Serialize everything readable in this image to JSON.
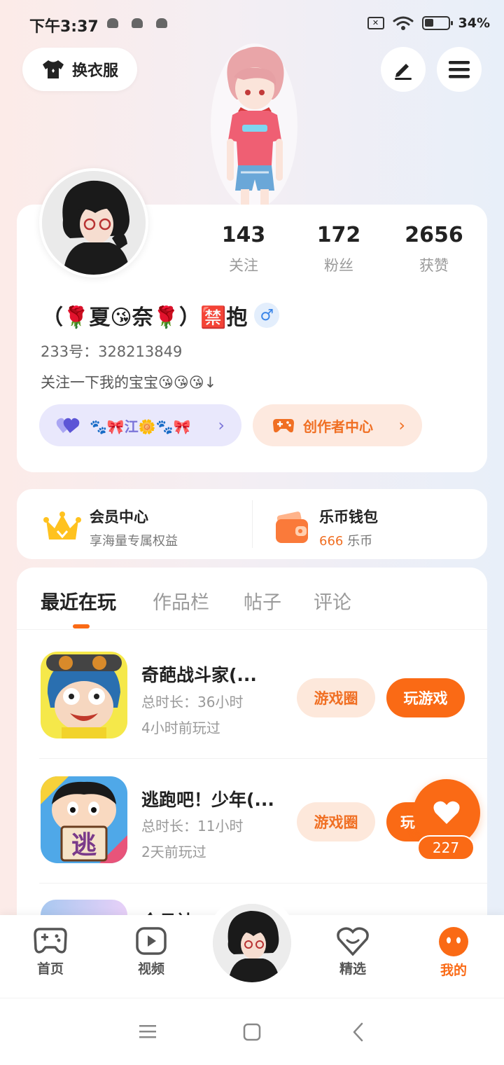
{
  "status_bar": {
    "time": "下午3:37",
    "battery": "34%",
    "sim_label": "✕"
  },
  "header": {
    "dress_label": "换衣服"
  },
  "profile": {
    "stats": [
      {
        "num": "143",
        "label": "关注"
      },
      {
        "num": "172",
        "label": "粉丝"
      },
      {
        "num": "2656",
        "label": "获赞"
      }
    ],
    "nickname": "（🌹夏😘奈🌹）🈲抱",
    "gender": "♂",
    "uid": "233号：328213849",
    "bio": "关注一下我的宝宝😘😘😘↓",
    "group_label": "🐾🎀江🌼🐾🎀",
    "creator_label": "创作者中心",
    "chevron": "›"
  },
  "vip": {
    "member_title": "会员中心",
    "member_sub": "享海量专属权益",
    "wallet_title": "乐币钱包",
    "wallet_amount": "666",
    "wallet_unit": " 乐币"
  },
  "tabs": [
    "最近在玩",
    "作品栏",
    "帖子",
    "评论"
  ],
  "games": [
    {
      "name": "奇葩战斗家(...",
      "duration": "总时长：36小时",
      "last_played": "4小时前玩过"
    },
    {
      "name": "逃跑吧！少年(...",
      "duration": "总时长：11小时",
      "last_played": "2天前玩过",
      "icon_text": "逃"
    },
    {
      "name": "金月神..."
    }
  ],
  "game_buttons": {
    "circle": "游戏圈",
    "play": "玩游戏",
    "play_partial": "玩"
  },
  "like_count": "227",
  "bottom_nav": [
    {
      "label": "首页"
    },
    {
      "label": "视频"
    },
    {
      "label": "精选"
    },
    {
      "label": "我的"
    }
  ],
  "colors": {
    "accent": "#fa6a15",
    "accent_light": "#fde8db",
    "group_pill": "#e9e8fc"
  }
}
